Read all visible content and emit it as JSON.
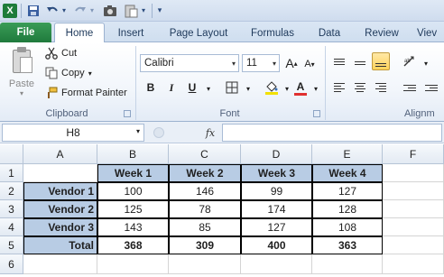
{
  "app": {
    "logo_letter": "X"
  },
  "quick_access": {
    "icons": [
      "excel-logo",
      "save-icon",
      "undo-icon",
      "redo-icon",
      "camera-icon",
      "paste-special-icon",
      "customize-icon"
    ]
  },
  "tabs": [
    {
      "label": "File",
      "active": false
    },
    {
      "label": "Home",
      "active": true
    },
    {
      "label": "Insert",
      "active": false
    },
    {
      "label": "Page Layout",
      "active": false
    },
    {
      "label": "Formulas",
      "active": false
    },
    {
      "label": "Data",
      "active": false
    },
    {
      "label": "Review",
      "active": false
    },
    {
      "label": "Viev",
      "active": false
    }
  ],
  "ribbon": {
    "clipboard": {
      "paste_label": "Paste",
      "cut_label": "Cut",
      "copy_label": "Copy",
      "format_painter_label": "Format Painter",
      "group_label": "Clipboard"
    },
    "font": {
      "font_name": "Calibri",
      "font_size": "11",
      "bold": "B",
      "italic": "I",
      "underline": "U",
      "group_label": "Font",
      "font_color_accent": "#e03030",
      "fill_color_accent": "#f2e000"
    },
    "alignment": {
      "group_label": "Alignm"
    }
  },
  "formula_bar": {
    "name_box": "H8",
    "fx_label": "fx",
    "formula": ""
  },
  "sheet": {
    "columns": [
      "A",
      "B",
      "C",
      "D",
      "E",
      "F"
    ],
    "rows": [
      "1",
      "2",
      "3",
      "4",
      "5",
      "6"
    ],
    "header_row": [
      "",
      "Week 1",
      "Week 2",
      "Week 3",
      "Week 4"
    ],
    "data": [
      {
        "label": "Vendor 1",
        "values": [
          "100",
          "146",
          "99",
          "127"
        ]
      },
      {
        "label": "Vendor 2",
        "values": [
          "125",
          "78",
          "174",
          "128"
        ]
      },
      {
        "label": "Vendor 3",
        "values": [
          "143",
          "85",
          "127",
          "108"
        ]
      }
    ],
    "total": {
      "label": "Total",
      "values": [
        "368",
        "309",
        "400",
        "363"
      ]
    },
    "accent_fill": "#b8cce4"
  }
}
